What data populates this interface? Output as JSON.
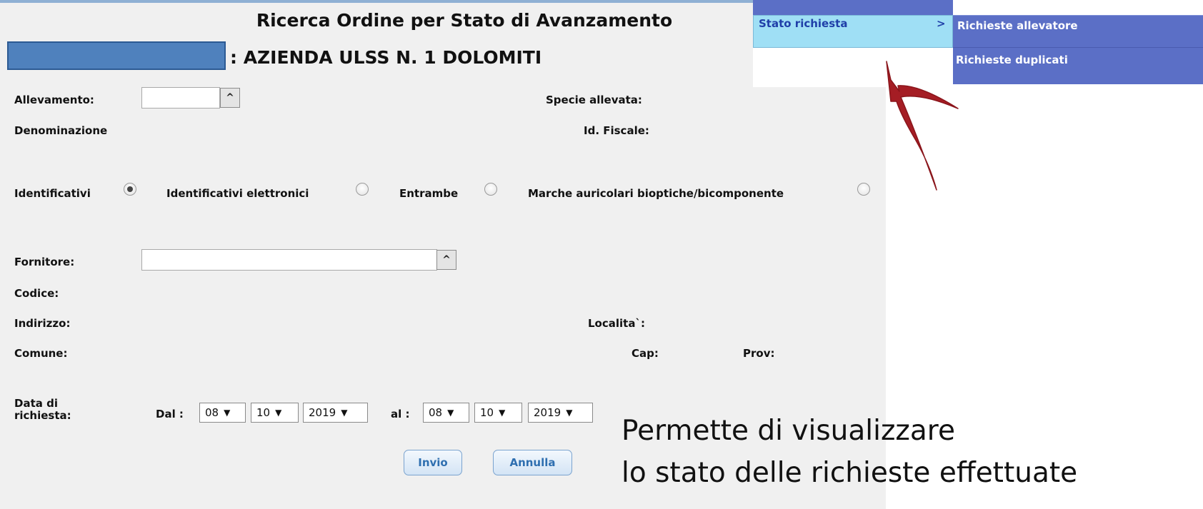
{
  "page": {
    "title": "Ricerca Ordine per Stato di Avanzamento",
    "azienda": ": AZIENDA ULSS N. 1 DOLOMITI"
  },
  "form": {
    "allevamento_label": "Allevamento:",
    "allevamento_value": "",
    "specie_label": "Specie allevata:",
    "denominazione_label": "Denominazione",
    "id_fiscale_label": "Id. Fiscale:",
    "radio_options": [
      {
        "label": "Identificativi",
        "selected": true
      },
      {
        "label": "Identificativi elettronici",
        "selected": false
      },
      {
        "label": "Entrambe",
        "selected": false
      },
      {
        "label": "Marche auricolari bioptiche/bicomponente",
        "selected": false
      }
    ],
    "fornitore_label": "Fornitore:",
    "fornitore_value": "",
    "codice_label": "Codice:",
    "indirizzo_label": "Indirizzo:",
    "localita_label": "Localita`:",
    "comune_label": "Comune:",
    "cap_label": "Cap:",
    "prov_label": "Prov:",
    "data_label_1": "Data di",
    "data_label_2": "richiesta:",
    "dal_label": "Dal :",
    "al_label": "al :",
    "dal": {
      "day": "08",
      "month": "10",
      "year": "2019"
    },
    "al": {
      "day": "08",
      "month": "10",
      "year": "2019"
    },
    "caret_symbol": "^",
    "dropdown_arrow": "▼",
    "invio_label": "Invio",
    "annulla_label": "Annulla"
  },
  "menu": {
    "item_label": "Stato richiesta",
    "item_arrow": ">",
    "submenu": [
      "Richieste allevatore",
      "Richieste duplicati"
    ]
  },
  "annotation": {
    "caption_line1": "Permette di visualizzare",
    "caption_line2": "lo stato delle richieste effettuate",
    "arrow_color": "#a51d24"
  },
  "colors": {
    "menu_blue": "#5b6fc6",
    "menu_item_bg": "#9fdff5",
    "redaction": "#4f81bd",
    "button_text": "#2f6fb0"
  }
}
